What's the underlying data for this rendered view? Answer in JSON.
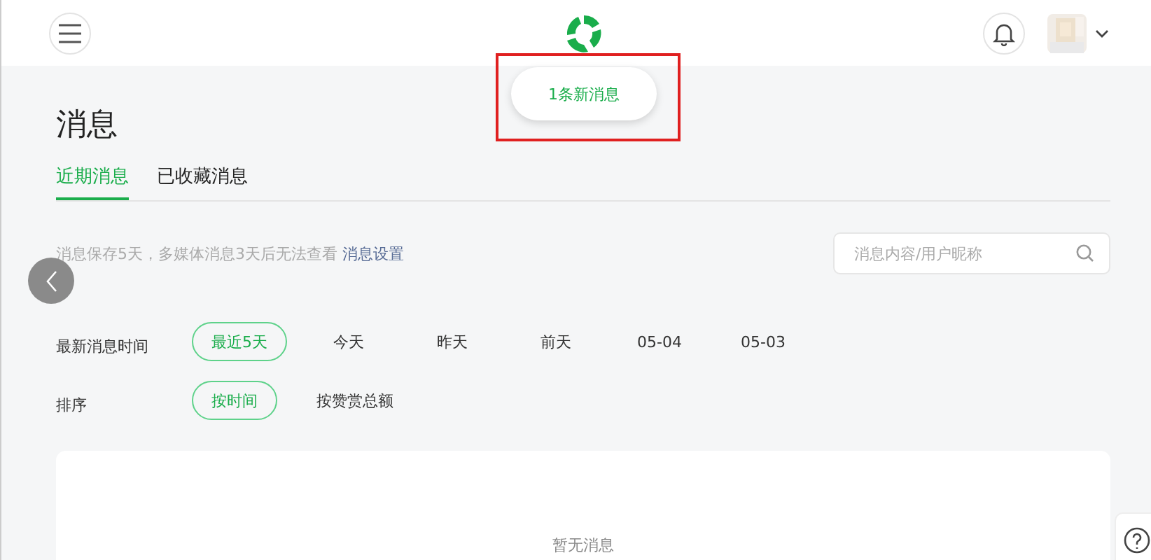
{
  "header": {
    "toast": "1条新消息",
    "highlighted": true
  },
  "page": {
    "title": "消息"
  },
  "tabs": [
    {
      "label": "近期消息",
      "selected": true
    },
    {
      "label": "已收藏消息",
      "selected": false
    }
  ],
  "notice": {
    "text": "消息保存5天，多媒体消息3天后无法查看",
    "link": "消息设置"
  },
  "search": {
    "placeholder": "消息内容/用户昵称"
  },
  "filters": [
    {
      "label": "最新消息时间",
      "options": [
        {
          "label": "最近5天",
          "selected": true
        },
        {
          "label": "今天",
          "selected": false
        },
        {
          "label": "昨天",
          "selected": false
        },
        {
          "label": "前天",
          "selected": false
        },
        {
          "label": "05-04",
          "selected": false
        },
        {
          "label": "05-03",
          "selected": false
        }
      ]
    },
    {
      "label": "排序",
      "options": [
        {
          "label": "按时间",
          "selected": true
        },
        {
          "label": "按赞赏总额",
          "selected": false
        }
      ]
    }
  ],
  "list": {
    "empty_text": "暂无消息"
  }
}
